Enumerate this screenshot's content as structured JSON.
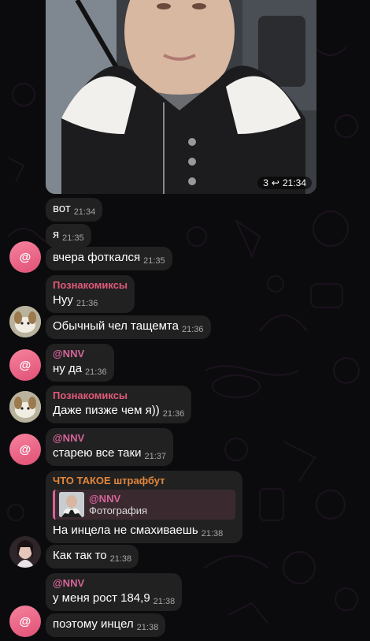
{
  "photo": {
    "replies_count": "3",
    "time": "21:34"
  },
  "messages": [
    {
      "text": "вот",
      "time": "21:34"
    },
    {
      "text": "я",
      "time": "21:35"
    },
    {
      "text": "вчера фоткался",
      "time": "21:35"
    },
    {
      "sender": "Познакомиксы",
      "text": "Нуу",
      "time": "21:36"
    },
    {
      "text": "Обычный чел тащемта",
      "time": "21:36"
    },
    {
      "sender": "@NNV",
      "text": "ну да",
      "time": "21:36"
    },
    {
      "sender": "Познакомиксы",
      "text": "Даже пизже чем я))",
      "time": "21:36"
    },
    {
      "sender": "@NNV",
      "text": "старею все таки",
      "time": "21:37"
    },
    {
      "sender": "ЧТО ТАКОЕ штрафбут",
      "reply_name": "@NNV",
      "reply_text": "Фотография",
      "text": "На инцела не смахиваешь",
      "time": "21:38"
    },
    {
      "text": "Как так то",
      "time": "21:38"
    },
    {
      "sender": "@NNV",
      "text": "у меня рост 184,9",
      "time": "21:38"
    },
    {
      "text": "поэтому инцел",
      "time": "21:38"
    }
  ],
  "avatar_at_symbol": "@",
  "colors": {
    "nnv": "#d6649a",
    "poznakomiksy": "#e05a7a",
    "shtrafbut": "#e3873b",
    "bubble": "#212121",
    "background": "#0b0b0d"
  }
}
